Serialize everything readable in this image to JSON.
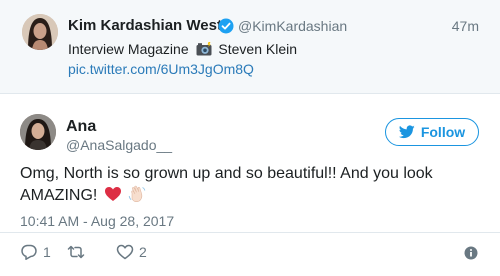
{
  "parent_tweet": {
    "author_name": "Kim Kardashian West",
    "author_handle": "@KimKardashian",
    "time": "47m",
    "text_before": "Interview Magazine",
    "text_after": "Steven Klein",
    "link": "pic.twitter.com/6Um3JgOm8Q",
    "icons": [
      "verified-badge-icon",
      "camera-flash-icon"
    ]
  },
  "tweet": {
    "author_name": "Ana",
    "author_handle": "@AnaSalgado__",
    "follow_label": "Follow",
    "text_line1": "Omg, North is so grown up and so beautiful!! And you look",
    "text_line2": "AMAZING!",
    "emojis": [
      "red-heart-icon",
      "waving-hand-icon"
    ],
    "timestamp": "10:41 AM - Aug 28, 2017"
  },
  "actions": {
    "reply_count": "1",
    "retweet_count": "",
    "like_count": "2",
    "icons": [
      "reply-icon",
      "retweet-icon",
      "like-icon",
      "info-icon"
    ]
  },
  "colors": {
    "accent": "#1b95e0",
    "link": "#2b7bb9",
    "muted": "#697882",
    "heart": "#e0245e"
  }
}
